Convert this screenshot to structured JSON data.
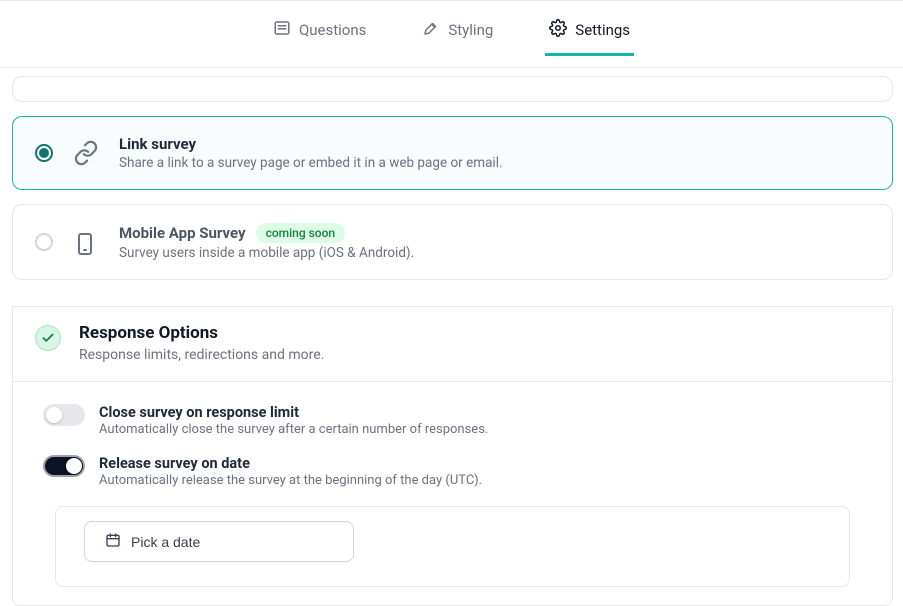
{
  "tabs": {
    "questions": "Questions",
    "styling": "Styling",
    "settings": "Settings"
  },
  "surveyTypes": {
    "link": {
      "title": "Link survey",
      "desc": "Share a link to a survey page or embed it in a web page or email."
    },
    "mobile": {
      "title": "Mobile App Survey",
      "badge": "coming soon",
      "desc": "Survey users inside a mobile app (iOS & Android)."
    }
  },
  "responseOptions": {
    "title": "Response Options",
    "subtitle": "Response limits, redirections and more.",
    "closeOnLimit": {
      "title": "Close survey on response limit",
      "desc": "Automatically close the survey after a certain number of responses."
    },
    "releaseOnDate": {
      "title": "Release survey on date",
      "desc": "Automatically release the survey at the beginning of the day (UTC)."
    },
    "pickDateLabel": "Pick a date"
  }
}
